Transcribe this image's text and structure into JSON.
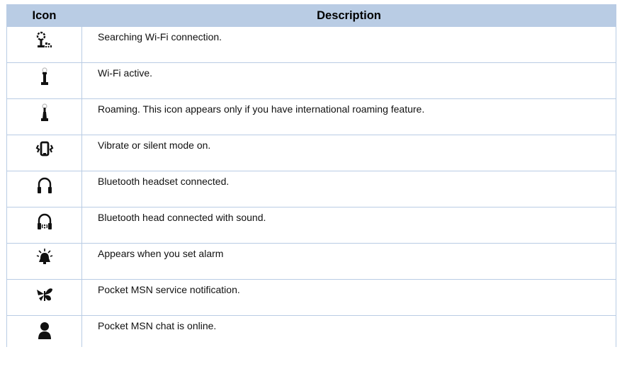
{
  "header": {
    "icon": "Icon",
    "description": "Description"
  },
  "rows": [
    {
      "icon": "wifi-searching-icon",
      "description": "Searching Wi-Fi connection."
    },
    {
      "icon": "wifi-active-icon",
      "description": "Wi-Fi active."
    },
    {
      "icon": "roaming-icon",
      "description": "Roaming. This icon appears only if you have international roaming feature."
    },
    {
      "icon": "vibrate-icon",
      "description": "Vibrate or silent mode on."
    },
    {
      "icon": "headset-icon",
      "description": "Bluetooth headset connected."
    },
    {
      "icon": "headset-sound-icon",
      "description": "Bluetooth head connected with sound."
    },
    {
      "icon": "alarm-bell-icon",
      "description": "Appears when you set alarm"
    },
    {
      "icon": "msn-butterfly-icon",
      "description": "Pocket MSN service notification."
    },
    {
      "icon": "msn-chat-person-icon",
      "description": "Pocket MSN chat is online."
    }
  ]
}
